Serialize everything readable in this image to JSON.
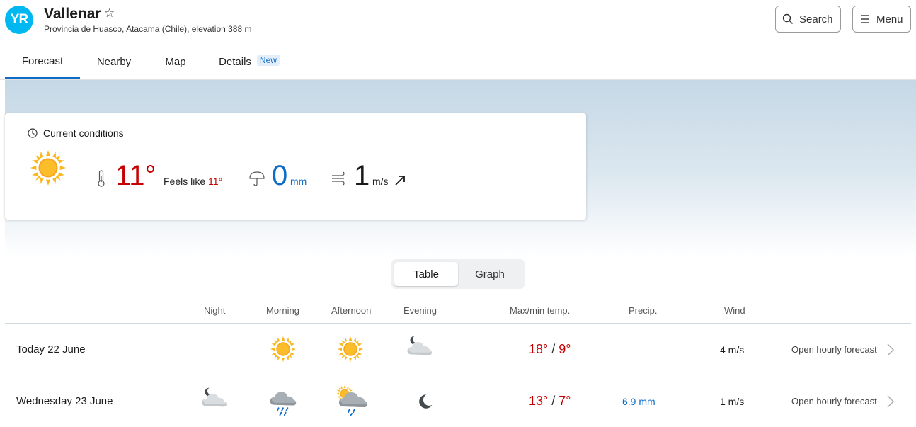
{
  "header": {
    "logo_text": "YR",
    "location_name": "Vallenar",
    "location_sub": "Provincia de Huasco, Atacama (Chile), elevation 388 m",
    "search_label": "Search",
    "menu_label": "Menu"
  },
  "tabs": [
    {
      "label": "Forecast",
      "active": true
    },
    {
      "label": "Nearby",
      "active": false
    },
    {
      "label": "Map",
      "active": false
    },
    {
      "label": "Details",
      "active": false,
      "badge": "New"
    }
  ],
  "current": {
    "title": "Current conditions",
    "icon": "sun-icon",
    "temp": "11°",
    "feels_label": "Feels like",
    "feels_value": "11°",
    "precip_value": "0",
    "precip_unit": "mm",
    "wind_value": "1",
    "wind_unit": "m/s"
  },
  "view_toggle": {
    "table": "Table",
    "graph": "Graph",
    "active": "table"
  },
  "table": {
    "headers": {
      "night": "Night",
      "morning": "Morning",
      "afternoon": "Afternoon",
      "evening": "Evening",
      "temp": "Max/min temp.",
      "precip": "Precip.",
      "wind": "Wind"
    },
    "rows": [
      {
        "day": "Today 22 June",
        "night": "",
        "morning": "sun-icon",
        "afternoon": "sun-icon",
        "evening": "moon-cloud-icon",
        "max": "18°",
        "min": "9°",
        "precip": "",
        "wind": "4 m/s",
        "open": "Open hourly forecast"
      },
      {
        "day": "Wednesday 23 June",
        "night": "moon-cloud-icon",
        "morning": "rain-cloud-icon",
        "afternoon": "sun-rain-cloud-icon",
        "evening": "moon-icon",
        "max": "13°",
        "min": "7°",
        "precip": "6.9 mm",
        "wind": "1 m/s",
        "open": "Open hourly forecast"
      }
    ]
  },
  "colors": {
    "accent": "#0f6cc6",
    "warm": "#c60000",
    "logo": "#00b8f1"
  }
}
